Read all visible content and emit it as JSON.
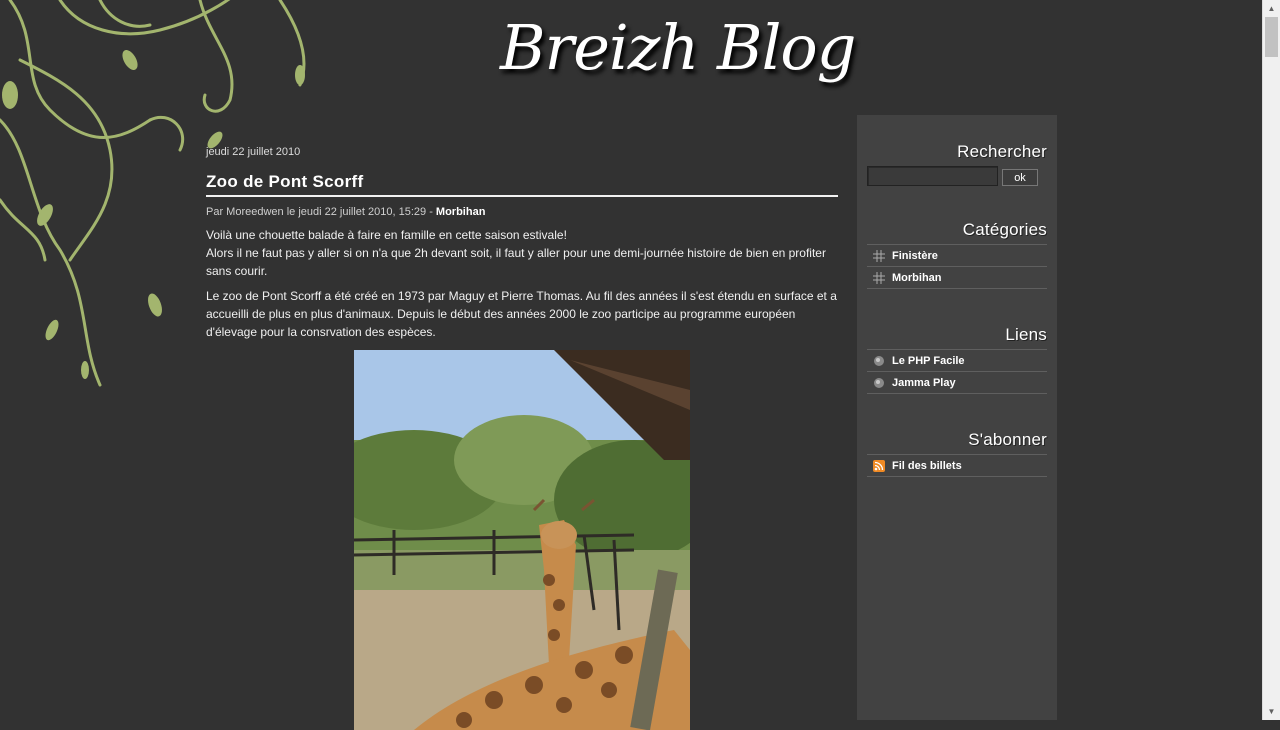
{
  "site": {
    "logo_text": "Breizh Blog"
  },
  "post": {
    "date": "jeudi 22 juillet 2010",
    "title": "Zoo de Pont Scorff",
    "meta_prefix": "Par Moreedwen le jeudi 22 juillet 2010, 15:29 - ",
    "category": "Morbihan",
    "paragraphs": [
      "Voilà une chouette balade à faire en famille en cette saison estivale!",
      "Alors il ne faut pas y aller si on n'a que 2h devant soit, il faut y aller pour une demi-journée histoire de bien en profiter sans courir.",
      "Le zoo de Pont Scorff a été créé en 1973 par Maguy et Pierre Thomas. Au fil des années il s'est étendu en surface et a accueilli de plus en plus d'animaux. Depuis le début des années 2000 le zoo participe au programme européen d'élevage pour la consrvation des espèces."
    ]
  },
  "sidebar": {
    "search": {
      "heading": "Rechercher",
      "value": "",
      "button": "ok"
    },
    "categories": {
      "heading": "Catégories",
      "items": [
        "Finistère",
        "Morbihan"
      ]
    },
    "links": {
      "heading": "Liens",
      "items": [
        "Le PHP Facile",
        "Jamma Play"
      ]
    },
    "subscribe": {
      "heading": "S'abonner",
      "items": [
        "Fil des billets"
      ]
    }
  },
  "colors": {
    "background": "#323232",
    "sidebar": "#424242",
    "accent_vine": "#a3b56e"
  },
  "icons": {
    "category": "cross-icon",
    "link": "link-bullet-icon",
    "feed": "rss-icon"
  }
}
